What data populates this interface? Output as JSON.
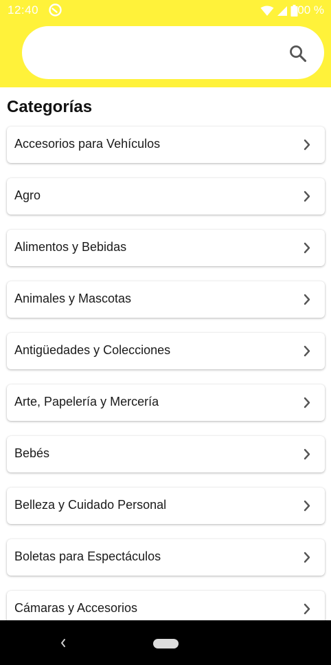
{
  "status_bar": {
    "time": "12:40",
    "battery_percent": "100 %",
    "icons": [
      "do-not-disturb-icon",
      "wifi-icon",
      "signal-icon",
      "battery-icon"
    ]
  },
  "search": {
    "value": "",
    "placeholder": "",
    "icon": "search-icon"
  },
  "page": {
    "title": "Categorías"
  },
  "categories": [
    {
      "label": "Accesorios para Vehículos"
    },
    {
      "label": "Agro"
    },
    {
      "label": "Alimentos y Bebidas"
    },
    {
      "label": "Animales y Mascotas"
    },
    {
      "label": "Antigüedades y Colecciones"
    },
    {
      "label": "Arte, Papelería y Mercería"
    },
    {
      "label": "Bebés"
    },
    {
      "label": "Belleza y Cuidado Personal"
    },
    {
      "label": "Boletas para Espectáculos"
    },
    {
      "label": "Cámaras y Accesorios"
    }
  ],
  "colors": {
    "header": "#fff23a",
    "card": "#ffffff",
    "text": "#1a1a1a",
    "navbar": "#000000"
  }
}
